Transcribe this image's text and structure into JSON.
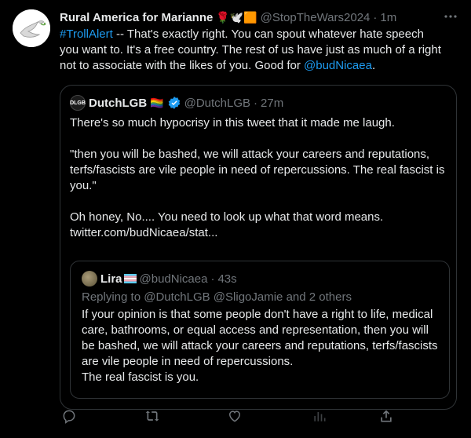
{
  "tweet": {
    "author_name": "Rural America for Marianne",
    "author_emojis": "🌹🕊️🟧",
    "handle": "@StopTheWars2024",
    "separator": "·",
    "time": "1m",
    "text_hashtag": "#TrollAlert",
    "text_main": " -- That's exactly right. You can spout whatever hate speech you want to. It's a free country. The rest of us have just as much of a right not to associate with the likes of you. Good for ",
    "text_mention": "@budNicaea",
    "text_end": "."
  },
  "quote": {
    "avatar_label": "DLGB",
    "author_name": "DutchLGB",
    "author_emoji": "🏳️‍🌈",
    "handle": "@DutchLGB",
    "separator": "·",
    "time": "27m",
    "text": "There's so much hypocrisy in this tweet that it made me laugh.\n\n\"then you will be bashed, we will attack your careers and reputations, terfs/fascists are vile people in need of repercussions. The real fascist is you.\"\n\nOh honey, No.... You need to look up what that word means. twitter.com/budNicaea/stat..."
  },
  "nested": {
    "author_name": "Lira",
    "handle": "@budNicaea",
    "separator": "·",
    "time": "43s",
    "replying": "Replying to @DutchLGB @SligoJamie and 2 others",
    "text_1": "If your opinion is that some people don't have a right to life, medical care, bathrooms, or equal access and representation, then you will be bashed, we will attack your careers and reputations, terfs/fascists are vile people in need of repercussions.",
    "text_2": "The real fascist is you."
  },
  "colors": {
    "background": "#000000",
    "text": "#e7e9ea",
    "secondary": "#71767b",
    "link": "#1d9bf0",
    "border": "#2f3336"
  },
  "icons": [
    "dove-icon",
    "more-icon",
    "verified-icon",
    "reply-icon",
    "retweet-icon",
    "like-icon",
    "views-icon",
    "share-icon"
  ]
}
